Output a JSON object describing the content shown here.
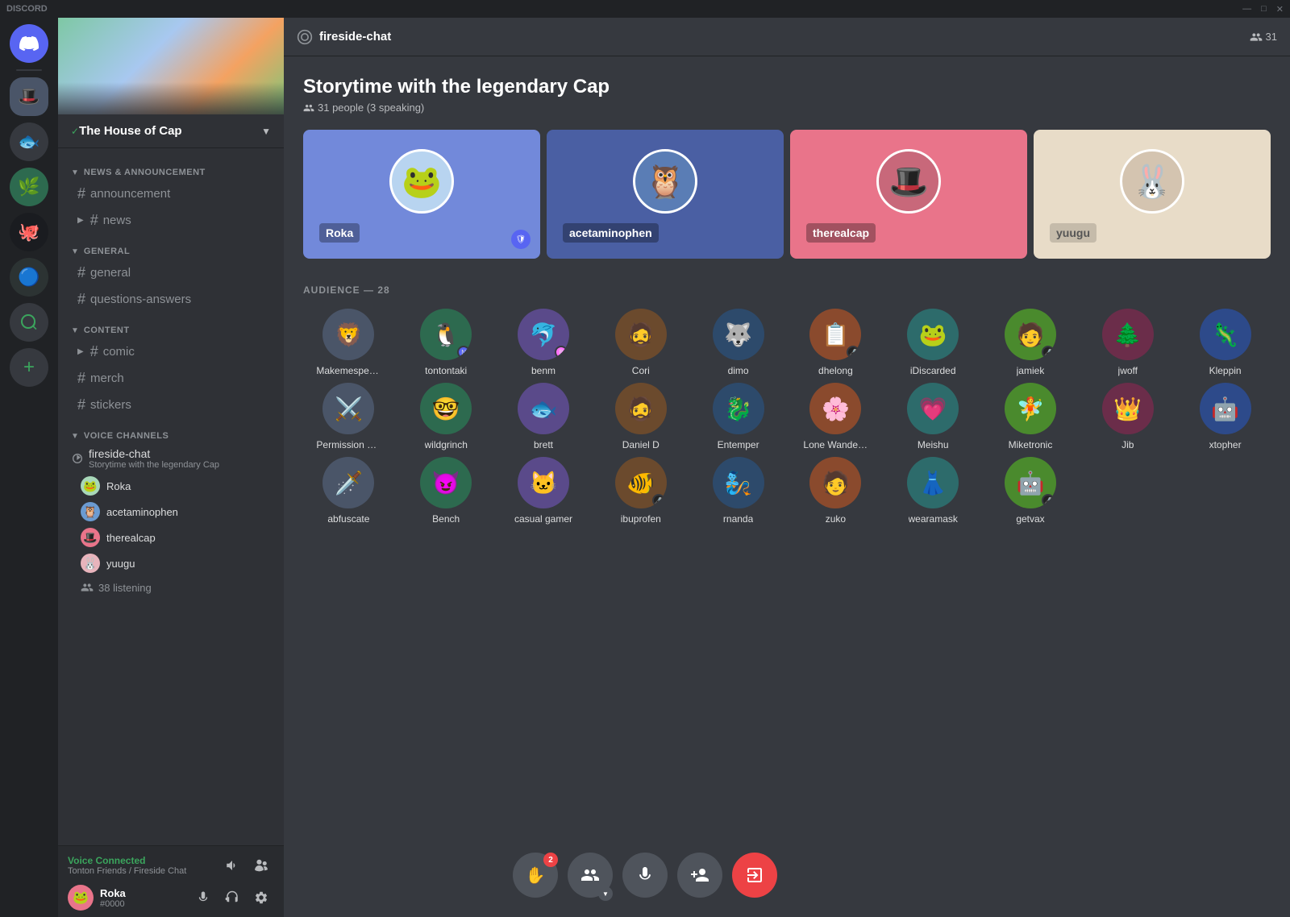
{
  "titlebar": {
    "app": "DISCORD",
    "minimize": "—",
    "maximize": "□",
    "close": "✕"
  },
  "server": {
    "name": "The House of Cap",
    "checkmark": "✓"
  },
  "header": {
    "channel": "fireside-chat",
    "members_icon": "👥",
    "member_count": "31"
  },
  "stage": {
    "title": "Storytime with the legendary Cap",
    "subtitle_icon": "👥",
    "subtitle": "31 people (3 speaking)"
  },
  "speakers": [
    {
      "id": "roka",
      "name": "Roka",
      "color": "blue",
      "emoji": "🐸",
      "shield": true
    },
    {
      "id": "acetaminophen",
      "name": "acetaminophen",
      "color": "dark-blue",
      "emoji": "🦉",
      "shield": false
    },
    {
      "id": "therealcap",
      "name": "therealcap",
      "color": "pink",
      "emoji": "🎩",
      "shield": false
    },
    {
      "id": "yuugu",
      "name": "yuugu",
      "color": "cream",
      "emoji": "🐰",
      "shield": false
    }
  ],
  "audience": {
    "label": "AUDIENCE — 28",
    "members": [
      {
        "name": "Makemespeakrr",
        "emoji": "🦁"
      },
      {
        "name": "tontontaki",
        "emoji": "🐧",
        "badge": "nitro"
      },
      {
        "name": "benm",
        "emoji": "🐬",
        "badge": "boost"
      },
      {
        "name": "Cori",
        "emoji": "🧔"
      },
      {
        "name": "dimo",
        "emoji": "🐺"
      },
      {
        "name": "dhelong",
        "emoji": "📋",
        "badge": "mic"
      },
      {
        "name": "iDiscarded",
        "emoji": "🐸"
      },
      {
        "name": "jamiek",
        "emoji": "🧑",
        "badge": "mic"
      },
      {
        "name": "jwoff",
        "emoji": "🌲"
      },
      {
        "name": "Kleppin",
        "emoji": "🦎"
      },
      {
        "name": "Permission Man",
        "emoji": "⚔️"
      },
      {
        "name": "wildgrinch",
        "emoji": "🤓"
      },
      {
        "name": "brett",
        "emoji": "🐟"
      },
      {
        "name": "Daniel D",
        "emoji": "🧔"
      },
      {
        "name": "Entemper",
        "emoji": "🐉"
      },
      {
        "name": "Lone Wanderer",
        "emoji": "🌸"
      },
      {
        "name": "Meishu",
        "emoji": "💗"
      },
      {
        "name": "Miketronic",
        "emoji": "🧚"
      },
      {
        "name": "Jib",
        "emoji": "👑"
      },
      {
        "name": "xtopher",
        "emoji": "🤖"
      },
      {
        "name": "abfuscate",
        "emoji": "🗡️"
      },
      {
        "name": "Bench",
        "emoji": "😈"
      },
      {
        "name": "casual gamer",
        "emoji": "🐱"
      },
      {
        "name": "ibuprofen",
        "emoji": "🐠",
        "badge": "mic"
      },
      {
        "name": "rnanda",
        "emoji": "🧞"
      },
      {
        "name": "zuko",
        "emoji": "🧑"
      },
      {
        "name": "wearamask",
        "emoji": "👗"
      },
      {
        "name": "getvax",
        "emoji": "🤖",
        "badge": "mic"
      }
    ]
  },
  "sidebar": {
    "categories": [
      {
        "name": "NEWS & ANNOUNCEMENT",
        "channels": [
          {
            "name": "announcement",
            "active": false
          },
          {
            "name": "news",
            "active": false,
            "collapsed": true
          }
        ]
      },
      {
        "name": "GENERAL",
        "channels": [
          {
            "name": "general",
            "active": false
          },
          {
            "name": "questions-answers",
            "active": false
          }
        ]
      },
      {
        "name": "CONTENT",
        "channels": [
          {
            "name": "comic",
            "active": false,
            "collapsed": true
          },
          {
            "name": "merch",
            "active": false
          },
          {
            "name": "stickers",
            "active": false
          }
        ]
      }
    ],
    "voice_channels": {
      "label": "VOICE CHANNELS",
      "channels": [
        {
          "name": "fireside-chat",
          "subtitle": "Storytime with the legendary Cap",
          "users": [
            {
              "name": "Roka",
              "emoji": "🐸"
            },
            {
              "name": "acetaminophen",
              "emoji": "🦉"
            },
            {
              "name": "therealcap",
              "emoji": "🎩"
            },
            {
              "name": "yuugu",
              "emoji": "🐰"
            }
          ],
          "listening": "38 listening"
        }
      ]
    }
  },
  "status_bar": {
    "voice_title": "Voice Connected",
    "voice_sub": "Tonton Friends / Fireside Chat",
    "user_name": "Roka",
    "user_disc": "#0000"
  },
  "toolbar": {
    "raise_hand_label": "✋",
    "raise_notif": "2",
    "invite_label": "👤",
    "mic_label": "🎤",
    "add_speaker_label": "👤",
    "leave_label": "→"
  }
}
